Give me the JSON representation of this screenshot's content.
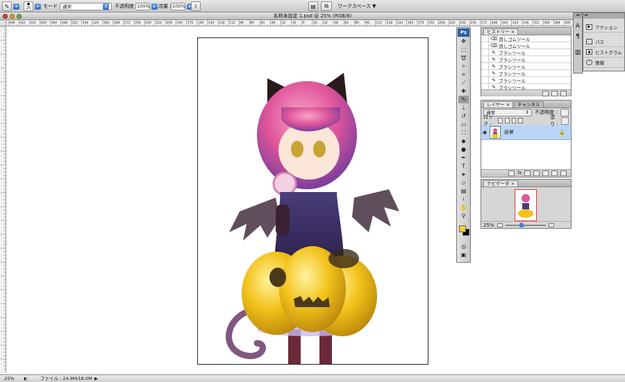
{
  "options_bar": {
    "brush_size": "25",
    "mode_label": "モード :",
    "mode_value": "通常",
    "opacity_label": "不透明度 :",
    "opacity_value": "100%",
    "flow_label": "流量 :",
    "flow_value": "100%",
    "workspace_label": "ワークスペース ▼"
  },
  "document": {
    "title": "名称未設定 1.psd @ 25% (RGB/8)",
    "h_ruler_ticks": [
      "448",
      "432",
      "416",
      "400",
      "384",
      "368",
      "352",
      "336",
      "320",
      "304",
      "288",
      "272",
      "256",
      "240",
      "224",
      "208",
      "192",
      "176",
      "160",
      "144",
      "128",
      "112",
      "96",
      "80",
      "64",
      "48",
      "32",
      "16",
      "0",
      "16",
      "32",
      "48",
      "64",
      "80",
      "96",
      "112",
      "128",
      "144",
      "160",
      "176",
      "192",
      "208",
      "224",
      "240",
      "256",
      "272",
      "288",
      "304",
      "320",
      "336",
      "352",
      "368",
      "384",
      "400",
      "416",
      "432",
      "448",
      "464",
      "480",
      "496",
      "512",
      "528",
      "544",
      "560",
      "576",
      "592",
      "608",
      "624",
      "640",
      "656",
      "672",
      "688",
      "704",
      "720",
      "736",
      "752",
      "768",
      "784",
      "800",
      "816",
      "832",
      "848",
      "864",
      "880",
      "896",
      "912",
      "928",
      "944",
      "960",
      "976",
      "992",
      "1008",
      "1024",
      "1040",
      "1056",
      "1072",
      "1088",
      "1104",
      "1120",
      "1136",
      "1152",
      "1168",
      "1184",
      "1200",
      "1216",
      "1232",
      "1248",
      "1264",
      "1280",
      "1296",
      "1312",
      "1328",
      "1344",
      "1360",
      "1376",
      "1392",
      "1408",
      "1424",
      "1440",
      "1456",
      "1472",
      "1488",
      "1504",
      "1520",
      "1536",
      "1552",
      "1568",
      "1584",
      "1600",
      "1616",
      "1632",
      "1648",
      "1664",
      "1680",
      "1696",
      "1712",
      "1728",
      "1744",
      "1760",
      "1776",
      "1792",
      "1808",
      "1824",
      "1840",
      "1856",
      "1872",
      "1888",
      "1904",
      "1920",
      "1936",
      "1952",
      "1968",
      "1984",
      "2000",
      "2016",
      "2032",
      "2048",
      "2064",
      "2080",
      "2096",
      "2112",
      "2128",
      "2144",
      "2160",
      "2176",
      "2192",
      "2208",
      "2224",
      "2240",
      "2256",
      "2272",
      "2288",
      "2304",
      "2320",
      "2336",
      "2352",
      "2368",
      "2384",
      "2400",
      "2416",
      "2432",
      "2448",
      "2464",
      "2480",
      "2496",
      "2512",
      "2528",
      "2544",
      "2560",
      "2576",
      "2592",
      "2608",
      "2624",
      "2640",
      "2656",
      "2672",
      "2688",
      "2704",
      "2720",
      "2736",
      "2752",
      "2768",
      "2784",
      "2800",
      "2816",
      "2832",
      "2848",
      "2864"
    ]
  },
  "status_bar": {
    "zoom": "25%",
    "file_info": "ファイル : 24.9M/18.0M"
  },
  "history_panel": {
    "tab": "ヒストリー",
    "items": [
      "消しゴムツール",
      "消しゴムツール",
      "ブラシツール",
      "ブラシツール",
      "ブラシツール",
      "ブラシツール",
      "ブラシツール",
      "ブラシツール"
    ]
  },
  "layers_panel": {
    "tabs": [
      "レイヤー",
      "チャンネル"
    ],
    "blend_mode": "通常",
    "opacity_label": "不透明度 :",
    "lock_label": "ロック :",
    "fill_label": "塗り :",
    "layer_name": "背景"
  },
  "navigator_panel": {
    "tab": "ナビゲータ",
    "zoom": "25%"
  },
  "toolbox": {
    "logo": "Ps"
  },
  "dock": {
    "items": [
      "アクション",
      "パス",
      "ヒストグラム",
      "情報"
    ]
  },
  "colors": {
    "foreground": "#f5d423",
    "background": "#000000",
    "layer_selected": "#b8d5f5"
  }
}
